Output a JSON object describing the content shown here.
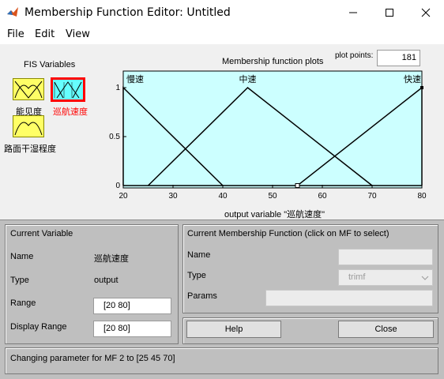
{
  "window": {
    "title": "Membership Function Editor: Untitled"
  },
  "menu": [
    {
      "label": "File"
    },
    {
      "label": "Edit"
    },
    {
      "label": "View"
    }
  ],
  "fis_variables": {
    "heading": "FIS Variables",
    "items": [
      {
        "label": "能见度",
        "selected": false
      },
      {
        "label": "巡航速度",
        "selected": true
      },
      {
        "label": "路面干湿程度",
        "selected": false
      }
    ]
  },
  "plot": {
    "title": "Membership function plots",
    "plot_points_label": "plot points:",
    "plot_points_value": "181"
  },
  "chart_data": {
    "type": "line",
    "title": "Membership function plots",
    "xlabel": "output variable \"巡航速度\"",
    "ylabel": "",
    "xlim": [
      20,
      80
    ],
    "ylim": [
      0,
      1
    ],
    "x_ticks": [
      "20",
      "30",
      "40",
      "50",
      "60",
      "70",
      "80"
    ],
    "y_ticks": [
      "0",
      "0.5",
      "1"
    ],
    "series": [
      {
        "name": "慢速",
        "x": [
          20,
          20,
          40
        ],
        "y": [
          0,
          1,
          0
        ]
      },
      {
        "name": "中速",
        "x": [
          25,
          45,
          70
        ],
        "y": [
          0,
          1,
          0
        ]
      },
      {
        "name": "快速",
        "x": [
          55,
          80,
          80
        ],
        "y": [
          0,
          1,
          0
        ]
      }
    ],
    "grid": false
  },
  "current_variable": {
    "heading": "Current Variable",
    "name_label": "Name",
    "name_value": "巡航速度",
    "type_label": "Type",
    "type_value": "output",
    "range_label": "Range",
    "range_value": "[20 80]",
    "display_range_label": "Display Range",
    "display_range_value": "[20 80]"
  },
  "current_mf": {
    "heading": "Current Membership Function (click on MF to select)",
    "name_label": "Name",
    "name_value": "",
    "type_label": "Type",
    "type_value": "trimf",
    "params_label": "Params",
    "params_value": ""
  },
  "buttons": {
    "help": "Help",
    "close": "Close"
  },
  "status": {
    "message": "Changing parameter for MF 2 to [25 45 70]"
  },
  "colors": {
    "plot_bg": "#ccffff",
    "selected_thumb": "#66ffff",
    "selected_border": "#ff0000",
    "thumb": "#ffff66",
    "selected_label": "#ff0000"
  }
}
